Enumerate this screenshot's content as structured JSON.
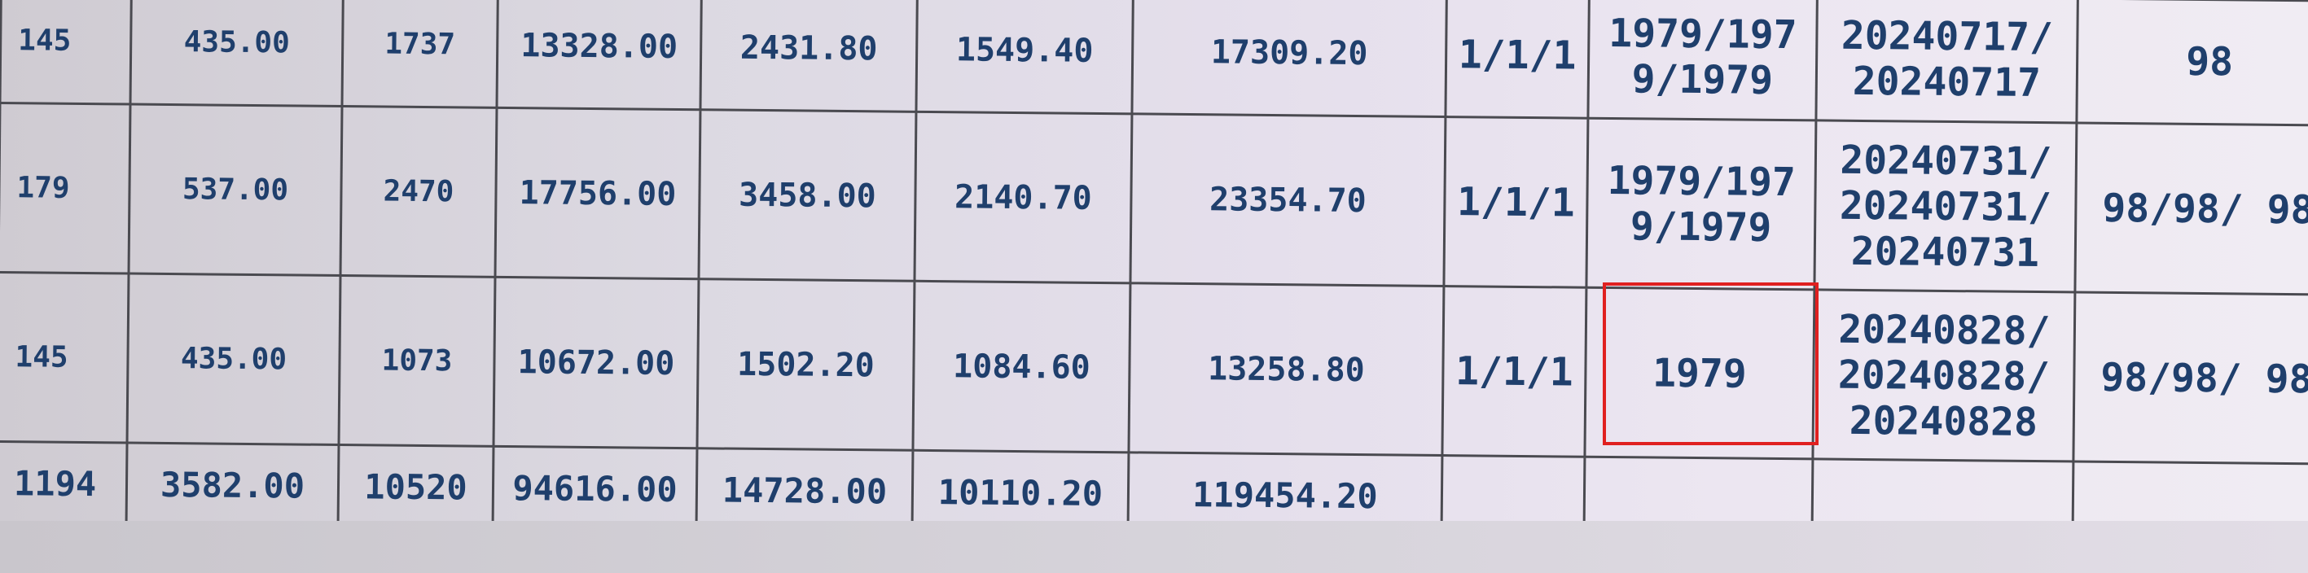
{
  "table": {
    "rows": [
      [
        "145",
        "435.00",
        "1737",
        "13328.00",
        "2431.80",
        "1549.40",
        "17309.20",
        "1/1/1",
        "1979/197 9/1979",
        "20240717/ 20240717",
        "98"
      ],
      [
        "179",
        "537.00",
        "2470",
        "17756.00",
        "3458.00",
        "2140.70",
        "23354.70",
        "1/1/1",
        "1979/197 9/1979",
        "20240731/ 20240731/ 20240731",
        "98/98/ 98"
      ],
      [
        "145",
        "435.00",
        "1073",
        "10672.00",
        "1502.20",
        "1084.60",
        "13258.80",
        "1/1/1",
        "1979",
        "20240828/ 20240828/ 20240828",
        "98/98/ 98"
      ],
      [
        "1194",
        "3582.00",
        "10520",
        "94616.00",
        "14728.00",
        "10110.20",
        "119454.20",
        "",
        "",
        "",
        ""
      ]
    ]
  },
  "highlight_color": "#e02020",
  "text_color": "#1f3f6c"
}
